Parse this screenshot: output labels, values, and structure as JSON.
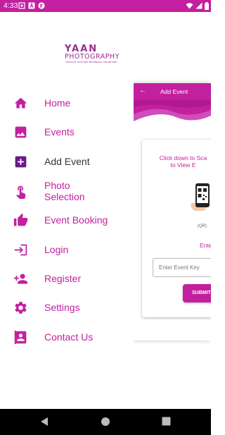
{
  "status_bar": {
    "time": "4:33",
    "background": "#c2209f"
  },
  "behind_screen": {
    "appbar_title": "Add Event",
    "scan_text_line1": "Click down to Sca",
    "scan_text_line2": "to View E",
    "qr_label": "(QR)",
    "enter_text": "Enter Even",
    "input_placeholder": "Enter Event Key",
    "submit_label": "SUBMIT"
  },
  "logo": {
    "main": "YAAN",
    "sub": "PHOTOGRAPHY",
    "tagline": "THROUGH YOUR NEW BEGINNINGS AND BEYOND"
  },
  "menu": [
    {
      "label": "Home",
      "icon": "home-icon"
    },
    {
      "label": "Events",
      "icon": "image-icon"
    },
    {
      "label": "Add Event",
      "icon": "add-box-icon"
    },
    {
      "label_line1": "Photo",
      "label_line2": "Selection",
      "icon": "touch-icon"
    },
    {
      "label": "Event Booking",
      "icon": "thumbs-up-icon"
    },
    {
      "label": "Login",
      "icon": "login-icon"
    },
    {
      "label": "Register",
      "icon": "person-add-icon"
    },
    {
      "label": "Settings",
      "icon": "gear-icon"
    },
    {
      "label": "Contact Us",
      "icon": "contact-icon"
    }
  ],
  "active_item": "Add Event",
  "colors": {
    "accent": "#c2209f",
    "active_text": "#333333"
  }
}
